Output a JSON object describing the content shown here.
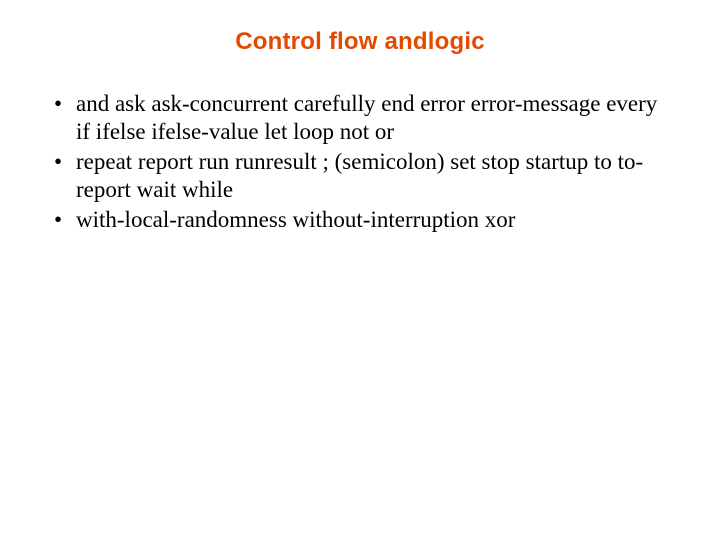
{
  "title": "Control flow andlogic",
  "bullets": [
    "and ask ask-concurrent carefully end error error-message every if ifelse ifelse-value let loop not or",
    "repeat report run runresult ; (semicolon) set stop startup to to-report wait while",
    "with-local-randomness without-interruption xor"
  ]
}
